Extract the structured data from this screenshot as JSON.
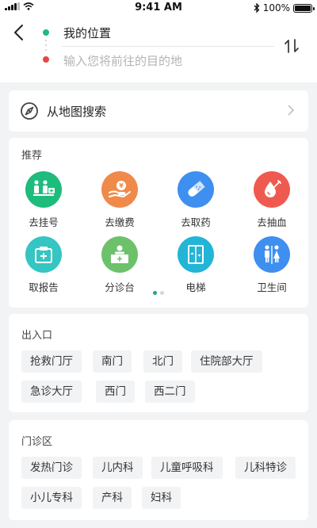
{
  "status_bar": {
    "time": "9:41 AM",
    "battery": "100%"
  },
  "route": {
    "from": "我的位置",
    "to_placeholder": "输入您将前往的目的地"
  },
  "map_search": {
    "label": "从地图搜索"
  },
  "recommend": {
    "title": "推荐",
    "items": [
      {
        "label": "去挂号",
        "icon": "registration-icon",
        "color": "#1ebc7c"
      },
      {
        "label": "去缴费",
        "icon": "payment-icon",
        "color": "#f08a4b"
      },
      {
        "label": "去取药",
        "icon": "medicine-icon",
        "color": "#3e8ff0"
      },
      {
        "label": "去抽血",
        "icon": "blood-draw-icon",
        "color": "#ef5a50"
      },
      {
        "label": "取报告",
        "icon": "report-icon",
        "color": "#35c5c2"
      },
      {
        "label": "分诊台",
        "icon": "triage-desk-icon",
        "color": "#6dc16b"
      },
      {
        "label": "电梯",
        "icon": "elevator-icon",
        "color": "#22b5d6"
      },
      {
        "label": "卫生间",
        "icon": "restroom-icon",
        "color": "#3e8ff0"
      }
    ],
    "page_active_color": "#1ea48e",
    "page_inactive_color": "#d6d6d6"
  },
  "entrance": {
    "title": "出入口",
    "tags": [
      "抢救门厅",
      "南门",
      "北门",
      "住院部大厅",
      "急诊大厅",
      "西门",
      "西二门"
    ]
  },
  "clinic": {
    "title": "门诊区",
    "tags": [
      "发热门诊",
      "儿内科",
      "儿童呼吸科",
      "儿科特诊",
      "小儿专科",
      "产科",
      "妇科"
    ]
  }
}
